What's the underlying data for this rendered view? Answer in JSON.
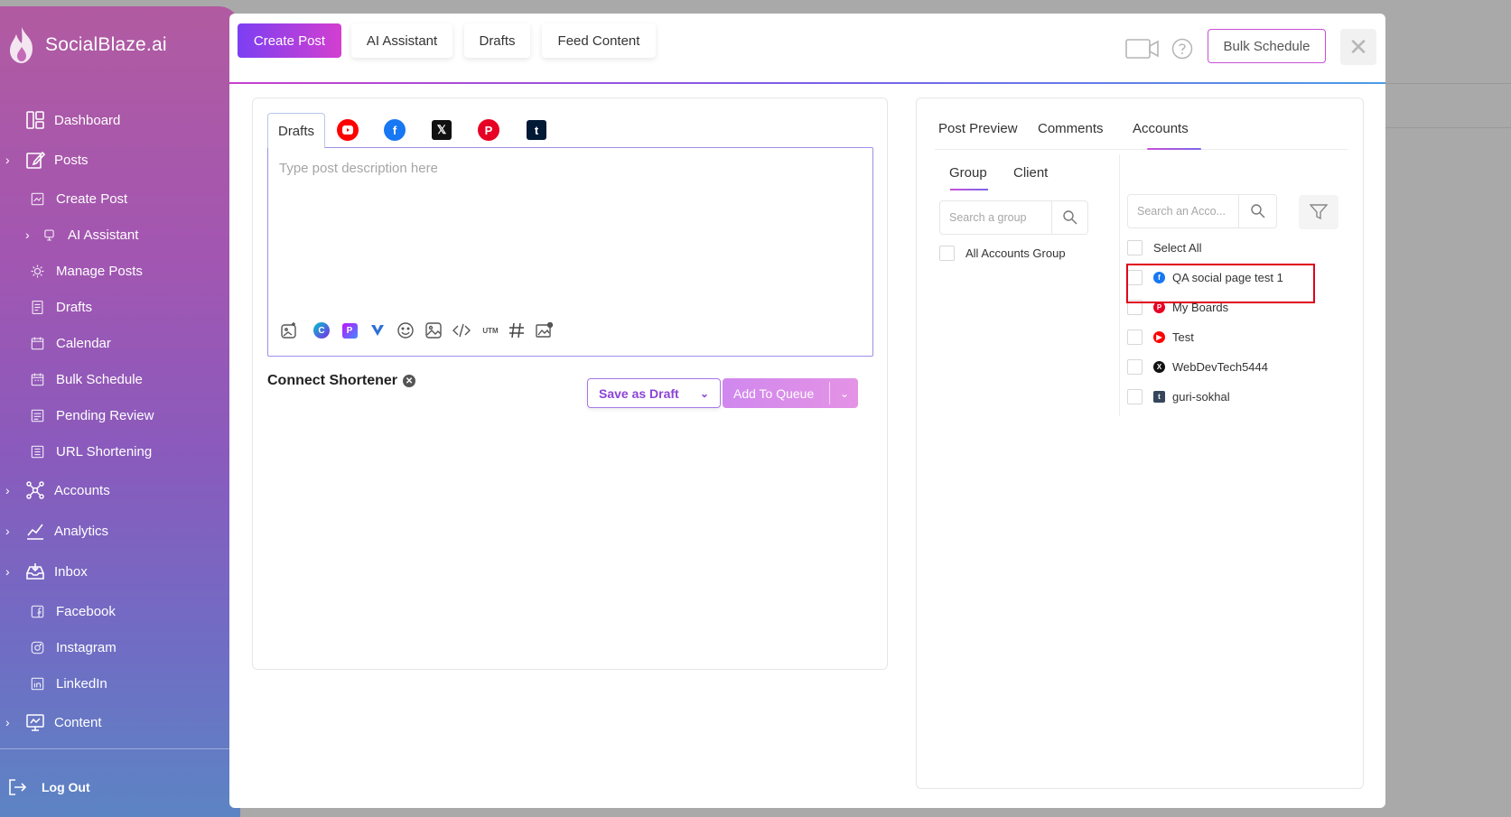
{
  "brand": {
    "name": "SocialBlaze.ai"
  },
  "sidebar": {
    "items": [
      {
        "label": "Dashboard",
        "icon": "dashboard-icon",
        "has_chevron": false
      },
      {
        "label": "Posts",
        "icon": "edit-icon",
        "has_chevron": true
      },
      {
        "label": "Create Post",
        "icon": "create-post-icon",
        "has_chevron": false
      },
      {
        "label": "AI Assistant",
        "icon": "ai-icon",
        "has_chevron": true
      },
      {
        "label": "Manage Posts",
        "icon": "gear-icon",
        "has_chevron": false
      },
      {
        "label": "Drafts",
        "icon": "drafts-icon",
        "has_chevron": false
      },
      {
        "label": "Calendar",
        "icon": "calendar-icon",
        "has_chevron": false
      },
      {
        "label": "Bulk Schedule",
        "icon": "calendar-icon",
        "has_chevron": false
      },
      {
        "label": "Pending Review",
        "icon": "review-icon",
        "has_chevron": false
      },
      {
        "label": "URL Shortening",
        "icon": "link-icon",
        "has_chevron": false
      },
      {
        "label": "Accounts",
        "icon": "network-icon",
        "has_chevron": true
      },
      {
        "label": "Analytics",
        "icon": "chart-icon",
        "has_chevron": true
      },
      {
        "label": "Inbox",
        "icon": "inbox-icon",
        "has_chevron": true
      },
      {
        "label": "Facebook",
        "icon": "facebook-icon",
        "has_chevron": false
      },
      {
        "label": "Instagram",
        "icon": "instagram-icon",
        "has_chevron": false
      },
      {
        "label": "LinkedIn",
        "icon": "linkedin-icon",
        "has_chevron": false
      },
      {
        "label": "Content",
        "icon": "content-icon",
        "has_chevron": true
      }
    ],
    "logout_label": "Log Out"
  },
  "modal": {
    "tabs": [
      "Create Post",
      "AI Assistant",
      "Drafts",
      "Feed Content"
    ],
    "active_tab": "Create Post",
    "bulk_schedule_label": "Bulk Schedule",
    "close_symbol": "✕"
  },
  "editor": {
    "drafts_tab_label": "Drafts",
    "platforms": [
      "youtube",
      "facebook",
      "x",
      "pinterest",
      "tumblr"
    ],
    "placeholder": "Type post description here",
    "value": "",
    "toolbar": [
      "image-ai",
      "canva",
      "picsart",
      "vista",
      "emoji",
      "media",
      "code",
      "UTM",
      "hashtag",
      "gallery"
    ],
    "utm_label": "UTM",
    "shortener_label": "Connect Shortener",
    "save_draft_label": "Save as Draft",
    "add_queue_label": "Add To Queue"
  },
  "right": {
    "tabs": [
      "Post Preview",
      "Comments",
      "Accounts"
    ],
    "active_tab": "Accounts",
    "subtabs": [
      "Group",
      "Client"
    ],
    "active_subtab": "Group",
    "group_search_placeholder": "Search a group",
    "account_search_placeholder": "Search an Acco...",
    "groups": [
      "All Accounts Group"
    ],
    "select_all_label": "Select All",
    "accounts": [
      {
        "name": "QA social page test 1",
        "platform": "facebook",
        "color": "#1877f2"
      },
      {
        "name": "My Boards",
        "platform": "pinterest",
        "color": "#e60023"
      },
      {
        "name": "Test",
        "platform": "youtube",
        "color": "#ff0000"
      },
      {
        "name": "WebDevTech5444",
        "platform": "x",
        "color": "#111111"
      },
      {
        "name": "guri-sokhal",
        "platform": "tumblr",
        "color": "#35465c"
      }
    ]
  },
  "colors": {
    "accent_gradient_start": "#7b3ff2",
    "accent_gradient_end": "#d33fd0",
    "highlight": "#e0001b"
  }
}
